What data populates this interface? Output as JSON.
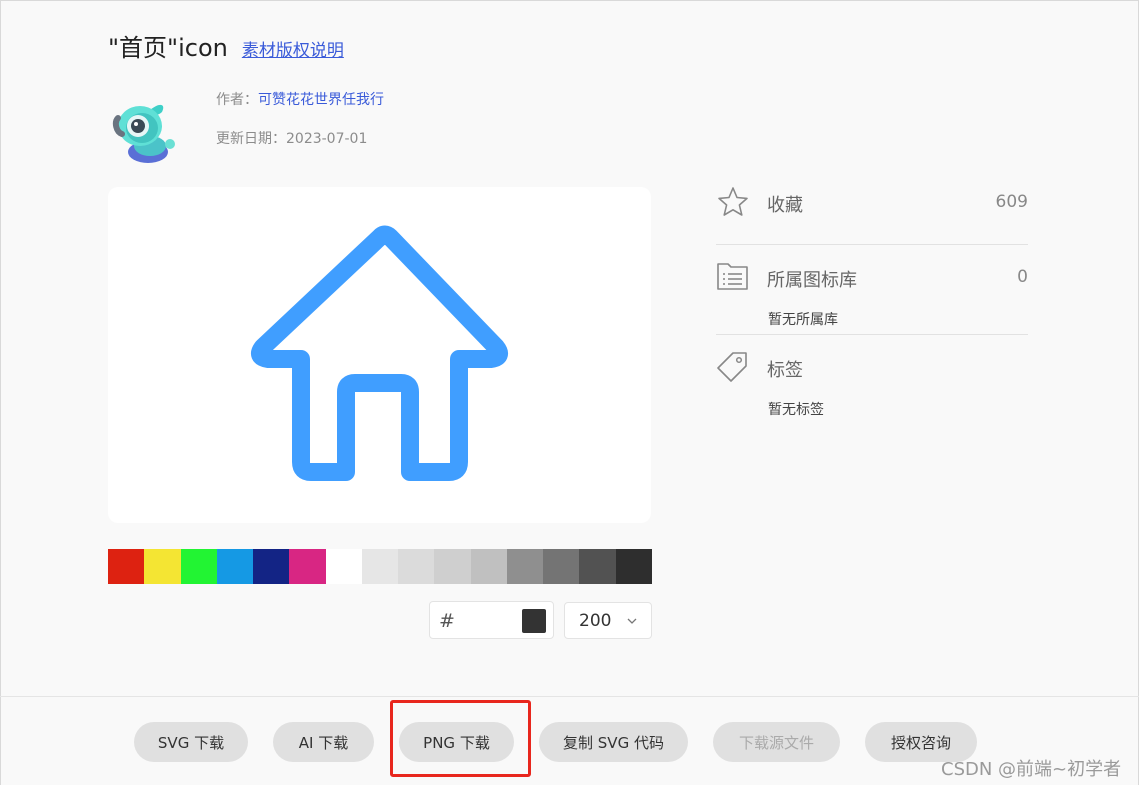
{
  "header": {
    "title": "\"首页\"icon",
    "license_link": "素材版权说明"
  },
  "meta": {
    "author_label": "作者：",
    "author_name": "可赞花花世界任我行",
    "date_label": "更新日期：",
    "date_value": "2023-07-01"
  },
  "preview": {
    "icon": "home-icon",
    "color": "#409eff"
  },
  "palette": {
    "colors": [
      "#dd2211",
      "#f4e533",
      "#22f433",
      "#1599e4",
      "#132485",
      "#d82683",
      "#ffffff",
      "#e6e6e6",
      "#dbdbdb",
      "#cfcfcf",
      "#c0c0c0",
      "#8f8f8f",
      "#747474",
      "#525252",
      "#2e2e2e"
    ]
  },
  "controls": {
    "hash_symbol": "#",
    "color_value": "",
    "size_value": "200"
  },
  "sidebar": {
    "favorite": {
      "label": "收藏",
      "count": "609",
      "icon": "star-icon"
    },
    "library": {
      "label": "所属图标库",
      "count": "0",
      "sub": "暂无所属库",
      "icon": "library-icon"
    },
    "tags": {
      "label": "标签",
      "sub": "暂无标签",
      "icon": "tag-icon"
    }
  },
  "actions": {
    "svg_download": "SVG 下载",
    "ai_download": "AI 下载",
    "png_download": "PNG 下载",
    "copy_svg": "复制 SVG 代码",
    "download_source": "下载源文件",
    "license_consult": "授权咨询"
  },
  "watermark": "CSDN @前端~初学者"
}
